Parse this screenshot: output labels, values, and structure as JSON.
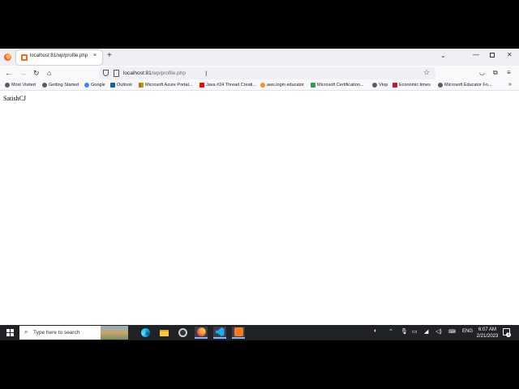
{
  "browser": {
    "tab": {
      "title": "localhost:81/wp/profile.php",
      "close_glyph": "×"
    },
    "newtab_glyph": "+",
    "url_host": "localhost:81",
    "url_path": "/wp/profile.php",
    "window": {
      "minimize_glyph": "—",
      "close_glyph": "✕"
    }
  },
  "bookmarks": [
    {
      "label": "Most Visited",
      "icon": "gear-icon",
      "color": "#5b5b66"
    },
    {
      "label": "Getting Started",
      "icon": "globe-icon",
      "color": "#5b5b66"
    },
    {
      "label": "Google",
      "icon": "google-icon",
      "color": "#4285f4"
    },
    {
      "label": "Outlook",
      "icon": "outlook-icon",
      "color": "#0a64ad"
    },
    {
      "label": "Microsoft Azure Portal...",
      "icon": "microsoft-icon",
      "color": "#7fba00"
    },
    {
      "label": "Java #24 Thread Creati...",
      "icon": "youtube-icon",
      "color": "#ff0000"
    },
    {
      "label": "aws.login educator",
      "icon": "aws-icon",
      "color": "#f7931e"
    },
    {
      "label": "Microsoft Certification...",
      "icon": "certification-icon",
      "color": "#2e9e4f"
    },
    {
      "label": "Vtop",
      "icon": "globe-icon",
      "color": "#5b5b66"
    },
    {
      "label": "Economic times",
      "icon": "et-icon",
      "color": "#c4182b"
    },
    {
      "label": "Microsoft Educator Fo...",
      "icon": "globe-icon",
      "color": "#5b5b66"
    }
  ],
  "page": {
    "body_text": "SatishCJ"
  },
  "taskbar": {
    "search_placeholder": "Type here to search",
    "language": "ENG",
    "time": "6:07 AM",
    "date": "2/21/2023",
    "notification_count": "1"
  }
}
